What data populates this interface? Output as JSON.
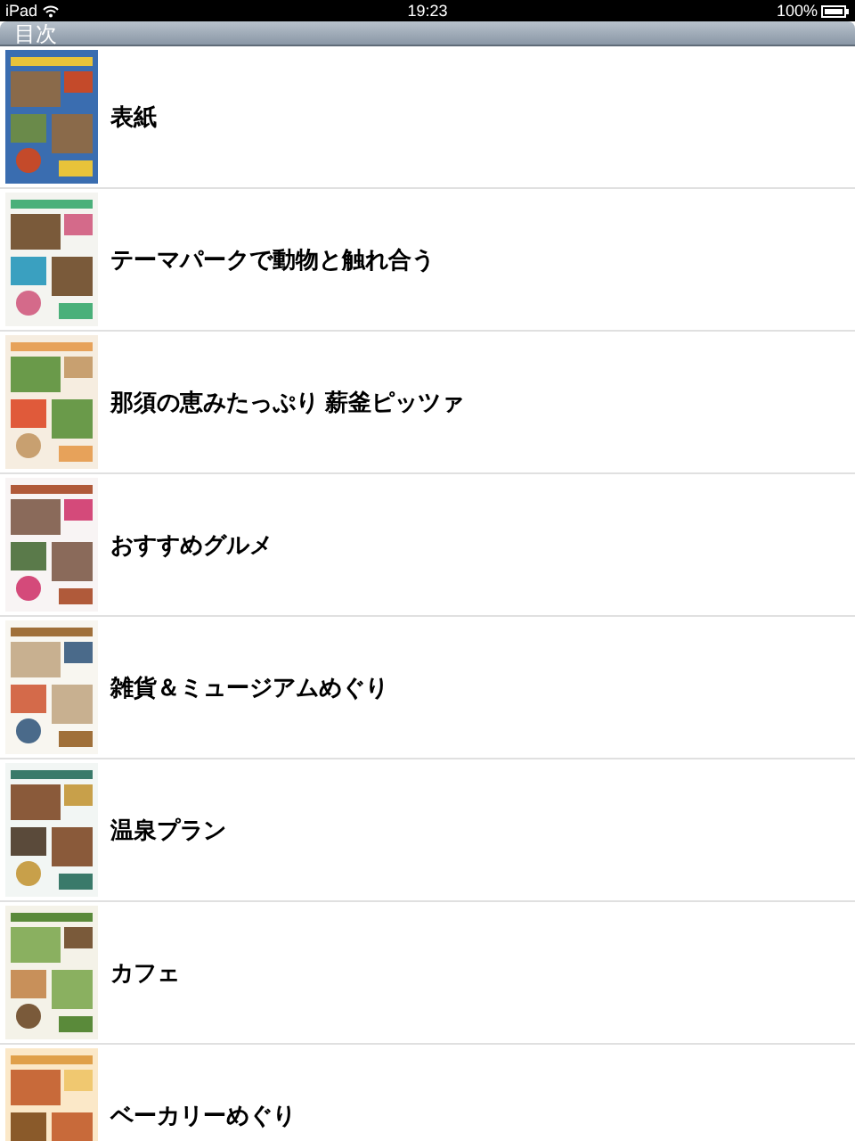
{
  "status_bar": {
    "device": "iPad",
    "time": "19:23",
    "battery": "100%"
  },
  "nav_bar": {
    "title": "目次"
  },
  "items": [
    {
      "title": "表紙"
    },
    {
      "title": "テーマパークで動物と触れ合う"
    },
    {
      "title": "那須の恵みたっぷり 薪釜ピッツァ"
    },
    {
      "title": "おすすめグルメ"
    },
    {
      "title": "雑貨＆ミュージアムめぐり"
    },
    {
      "title": "温泉プラン"
    },
    {
      "title": "カフェ"
    },
    {
      "title": "ベーカリーめぐり"
    }
  ]
}
